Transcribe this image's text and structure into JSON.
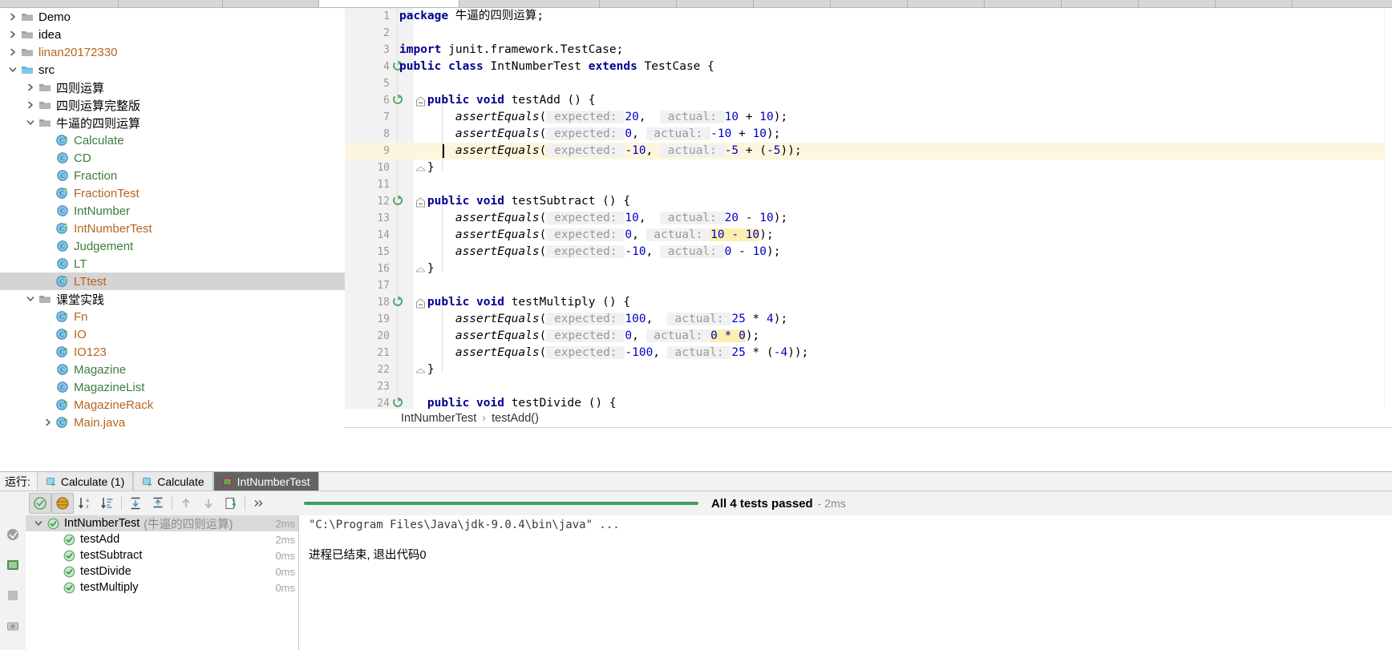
{
  "window": {
    "editor_tabs_cut_off": true
  },
  "project_tree": {
    "items": [
      {
        "label": "Demo",
        "indent": 1,
        "arrow": "collapsed",
        "icon": "folder-icon",
        "color": "black",
        "selected": false
      },
      {
        "label": "idea",
        "indent": 1,
        "arrow": "collapsed",
        "icon": "folder-icon",
        "color": "black",
        "selected": false
      },
      {
        "label": "linan20172330",
        "indent": 1,
        "arrow": "collapsed",
        "icon": "folder-icon",
        "color": "orange",
        "selected": false
      },
      {
        "label": "src",
        "indent": 1,
        "arrow": "expanded",
        "icon": "source-folder-icon",
        "color": "black",
        "selected": false
      },
      {
        "label": "四则运算",
        "indent": 2,
        "arrow": "collapsed",
        "icon": "package-icon",
        "color": "black",
        "selected": false
      },
      {
        "label": "四则运算完整版",
        "indent": 2,
        "arrow": "collapsed",
        "icon": "package-icon",
        "color": "black",
        "selected": false
      },
      {
        "label": "牛逼的四则运算",
        "indent": 2,
        "arrow": "expanded",
        "icon": "package-icon",
        "color": "black",
        "selected": false
      },
      {
        "label": "Calculate",
        "indent": 3,
        "arrow": "none",
        "icon": "java-class-run-icon",
        "color": "green",
        "selected": false
      },
      {
        "label": "CD",
        "indent": 3,
        "arrow": "none",
        "icon": "java-class-icon",
        "color": "green",
        "selected": false
      },
      {
        "label": "Fraction",
        "indent": 3,
        "arrow": "none",
        "icon": "java-class-icon",
        "color": "green",
        "selected": false
      },
      {
        "label": "FractionTest",
        "indent": 3,
        "arrow": "none",
        "icon": "java-test-class-icon",
        "color": "orange",
        "selected": false
      },
      {
        "label": "IntNumber",
        "indent": 3,
        "arrow": "none",
        "icon": "java-class-icon",
        "color": "green",
        "selected": false
      },
      {
        "label": "IntNumberTest",
        "indent": 3,
        "arrow": "none",
        "icon": "java-test-class-icon",
        "color": "orange",
        "selected": false
      },
      {
        "label": "Judgement",
        "indent": 3,
        "arrow": "none",
        "icon": "java-class-icon",
        "color": "green",
        "selected": false
      },
      {
        "label": "LT",
        "indent": 3,
        "arrow": "none",
        "icon": "java-class-icon",
        "color": "green",
        "selected": false
      },
      {
        "label": "LTtest",
        "indent": 3,
        "arrow": "none",
        "icon": "java-test-class-icon",
        "color": "orange",
        "selected": true
      },
      {
        "label": "课堂实践",
        "indent": 2,
        "arrow": "expanded",
        "icon": "package-icon",
        "color": "black",
        "selected": false
      },
      {
        "label": "Fn",
        "indent": 3,
        "arrow": "none",
        "icon": "java-class-run-icon",
        "color": "orange",
        "selected": false
      },
      {
        "label": "IO",
        "indent": 3,
        "arrow": "none",
        "icon": "java-class-run-icon",
        "color": "orange",
        "selected": false
      },
      {
        "label": "IO123",
        "indent": 3,
        "arrow": "none",
        "icon": "java-class-run-icon",
        "color": "orange",
        "selected": false
      },
      {
        "label": "Magazine",
        "indent": 3,
        "arrow": "none",
        "icon": "java-class-icon",
        "color": "green",
        "selected": false
      },
      {
        "label": "MagazineList",
        "indent": 3,
        "arrow": "none",
        "icon": "java-class-icon",
        "color": "green",
        "selected": false
      },
      {
        "label": "MagazineRack",
        "indent": 3,
        "arrow": "none",
        "icon": "java-class-run-icon",
        "color": "orange",
        "selected": false
      },
      {
        "label": "Main.java",
        "indent": 3,
        "arrow": "collapsed",
        "icon": "java-class-run-icon",
        "color": "orange",
        "selected": false
      }
    ]
  },
  "editor": {
    "breadcrumb": {
      "class": "IntNumberTest",
      "separator": "›",
      "member": "testAdd()"
    },
    "current_line": 9,
    "lines": [
      {
        "n": 1,
        "runmark": false,
        "fold": "none",
        "tokens": [
          {
            "t": "package ",
            "c": "kw"
          },
          {
            "t": "牛逼的四则运算",
            "c": "plain"
          },
          {
            "t": ";",
            "c": "plain"
          }
        ]
      },
      {
        "n": 2,
        "runmark": false,
        "fold": "none",
        "tokens": []
      },
      {
        "n": 3,
        "runmark": false,
        "fold": "none",
        "tokens": [
          {
            "t": "import ",
            "c": "kw"
          },
          {
            "t": "junit.framework.TestCase;",
            "c": "plain"
          }
        ]
      },
      {
        "n": 4,
        "runmark": true,
        "fold": "none",
        "tokens": [
          {
            "t": "public class ",
            "c": "kw"
          },
          {
            "t": "IntNumberTest ",
            "c": "plain"
          },
          {
            "t": "extends ",
            "c": "kw"
          },
          {
            "t": "TestCase {",
            "c": "plain"
          }
        ]
      },
      {
        "n": 5,
        "runmark": false,
        "fold": "none",
        "tokens": []
      },
      {
        "n": 6,
        "runmark": true,
        "fold": "start",
        "indent": 1,
        "tokens": [
          {
            "t": "    ",
            "c": "plain"
          },
          {
            "t": "public void ",
            "c": "kw"
          },
          {
            "t": "testAdd () {",
            "c": "plain"
          }
        ]
      },
      {
        "n": 7,
        "runmark": false,
        "fold": "none",
        "indent": 1,
        "tokens": [
          {
            "t": "        ",
            "c": "plain"
          },
          {
            "t": "assertEquals",
            "c": "mth"
          },
          {
            "t": "(",
            "c": "plain"
          },
          {
            "t": " expected: ",
            "c": "hint"
          },
          {
            "t": "20",
            "c": "num"
          },
          {
            "t": ",  ",
            "c": "plain"
          },
          {
            "t": " actual: ",
            "c": "hint"
          },
          {
            "t": "10",
            "c": "num"
          },
          {
            "t": " + ",
            "c": "plain"
          },
          {
            "t": "10",
            "c": "num"
          },
          {
            "t": ");",
            "c": "plain"
          }
        ]
      },
      {
        "n": 8,
        "runmark": false,
        "fold": "none",
        "indent": 1,
        "tokens": [
          {
            "t": "        ",
            "c": "plain"
          },
          {
            "t": "assertEquals",
            "c": "mth"
          },
          {
            "t": "(",
            "c": "plain"
          },
          {
            "t": " expected: ",
            "c": "hint"
          },
          {
            "t": "0",
            "c": "num"
          },
          {
            "t": ", ",
            "c": "plain"
          },
          {
            "t": " actual: ",
            "c": "hint"
          },
          {
            "t": "-10",
            "c": "num"
          },
          {
            "t": " + ",
            "c": "plain"
          },
          {
            "t": "10",
            "c": "num"
          },
          {
            "t": ");",
            "c": "plain"
          }
        ]
      },
      {
        "n": 9,
        "runmark": false,
        "fold": "none",
        "indent": 1,
        "caret": true,
        "tokens": [
          {
            "t": "        ",
            "c": "plain"
          },
          {
            "t": "assertEquals",
            "c": "mth"
          },
          {
            "t": "(",
            "c": "plain"
          },
          {
            "t": " expected: ",
            "c": "hint"
          },
          {
            "t": "-10",
            "c": "num"
          },
          {
            "t": ", ",
            "c": "plain"
          },
          {
            "t": " actual: ",
            "c": "hint"
          },
          {
            "t": "-5",
            "c": "num"
          },
          {
            "t": " + (",
            "c": "plain"
          },
          {
            "t": "-5",
            "c": "num"
          },
          {
            "t": "));",
            "c": "plain"
          }
        ]
      },
      {
        "n": 10,
        "runmark": false,
        "fold": "end",
        "tokens": [
          {
            "t": "    }",
            "c": "plain"
          }
        ]
      },
      {
        "n": 11,
        "runmark": false,
        "fold": "none",
        "tokens": []
      },
      {
        "n": 12,
        "runmark": true,
        "fold": "start",
        "indent": 1,
        "tokens": [
          {
            "t": "    ",
            "c": "plain"
          },
          {
            "t": "public void ",
            "c": "kw"
          },
          {
            "t": "testSubtract () {",
            "c": "plain"
          }
        ]
      },
      {
        "n": 13,
        "runmark": false,
        "fold": "none",
        "indent": 1,
        "tokens": [
          {
            "t": "        ",
            "c": "plain"
          },
          {
            "t": "assertEquals",
            "c": "mth"
          },
          {
            "t": "(",
            "c": "plain"
          },
          {
            "t": " expected: ",
            "c": "hint"
          },
          {
            "t": "10",
            "c": "num"
          },
          {
            "t": ",  ",
            "c": "plain"
          },
          {
            "t": " actual: ",
            "c": "hint"
          },
          {
            "t": "20",
            "c": "num"
          },
          {
            "t": " - ",
            "c": "plain"
          },
          {
            "t": "10",
            "c": "num"
          },
          {
            "t": ");",
            "c": "plain"
          }
        ]
      },
      {
        "n": 14,
        "runmark": false,
        "fold": "none",
        "indent": 1,
        "tokens": [
          {
            "t": "        ",
            "c": "plain"
          },
          {
            "t": "assertEquals",
            "c": "mth"
          },
          {
            "t": "(",
            "c": "plain"
          },
          {
            "t": " expected: ",
            "c": "hint"
          },
          {
            "t": "0",
            "c": "num"
          },
          {
            "t": ", ",
            "c": "plain"
          },
          {
            "t": " actual: ",
            "c": "hint"
          },
          {
            "t": "10 - 10",
            "c": "num hl-yellow"
          },
          {
            "t": ");",
            "c": "plain"
          }
        ]
      },
      {
        "n": 15,
        "runmark": false,
        "fold": "none",
        "indent": 1,
        "tokens": [
          {
            "t": "        ",
            "c": "plain"
          },
          {
            "t": "assertEquals",
            "c": "mth"
          },
          {
            "t": "(",
            "c": "plain"
          },
          {
            "t": " expected: ",
            "c": "hint"
          },
          {
            "t": "-10",
            "c": "num"
          },
          {
            "t": ", ",
            "c": "plain"
          },
          {
            "t": " actual: ",
            "c": "hint"
          },
          {
            "t": "0",
            "c": "num"
          },
          {
            "t": " - ",
            "c": "plain"
          },
          {
            "t": "10",
            "c": "num"
          },
          {
            "t": ");",
            "c": "plain"
          }
        ]
      },
      {
        "n": 16,
        "runmark": false,
        "fold": "end",
        "tokens": [
          {
            "t": "    }",
            "c": "plain"
          }
        ]
      },
      {
        "n": 17,
        "runmark": false,
        "fold": "none",
        "tokens": []
      },
      {
        "n": 18,
        "runmark": true,
        "fold": "start",
        "indent": 1,
        "tokens": [
          {
            "t": "    ",
            "c": "plain"
          },
          {
            "t": "public void ",
            "c": "kw"
          },
          {
            "t": "testMultiply () {",
            "c": "plain"
          }
        ]
      },
      {
        "n": 19,
        "runmark": false,
        "fold": "none",
        "indent": 1,
        "tokens": [
          {
            "t": "        ",
            "c": "plain"
          },
          {
            "t": "assertEquals",
            "c": "mth"
          },
          {
            "t": "(",
            "c": "plain"
          },
          {
            "t": " expected: ",
            "c": "hint"
          },
          {
            "t": "100",
            "c": "num"
          },
          {
            "t": ",  ",
            "c": "plain"
          },
          {
            "t": " actual: ",
            "c": "hint"
          },
          {
            "t": "25",
            "c": "num"
          },
          {
            "t": " * ",
            "c": "plain"
          },
          {
            "t": "4",
            "c": "num"
          },
          {
            "t": ");",
            "c": "plain"
          }
        ]
      },
      {
        "n": 20,
        "runmark": false,
        "fold": "none",
        "indent": 1,
        "tokens": [
          {
            "t": "        ",
            "c": "plain"
          },
          {
            "t": "assertEquals",
            "c": "mth"
          },
          {
            "t": "(",
            "c": "plain"
          },
          {
            "t": " expected: ",
            "c": "hint"
          },
          {
            "t": "0",
            "c": "num"
          },
          {
            "t": ", ",
            "c": "plain"
          },
          {
            "t": " actual: ",
            "c": "hint"
          },
          {
            "t": "0 * 0",
            "c": "num hl-yellow"
          },
          {
            "t": ");",
            "c": "plain"
          }
        ]
      },
      {
        "n": 21,
        "runmark": false,
        "fold": "none",
        "indent": 1,
        "tokens": [
          {
            "t": "        ",
            "c": "plain"
          },
          {
            "t": "assertEquals",
            "c": "mth"
          },
          {
            "t": "(",
            "c": "plain"
          },
          {
            "t": " expected: ",
            "c": "hint"
          },
          {
            "t": "-100",
            "c": "num"
          },
          {
            "t": ", ",
            "c": "plain"
          },
          {
            "t": " actual: ",
            "c": "hint"
          },
          {
            "t": "25",
            "c": "num"
          },
          {
            "t": " * (",
            "c": "plain"
          },
          {
            "t": "-4",
            "c": "num"
          },
          {
            "t": "));",
            "c": "plain"
          }
        ]
      },
      {
        "n": 22,
        "runmark": false,
        "fold": "end",
        "tokens": [
          {
            "t": "    }",
            "c": "plain"
          }
        ]
      },
      {
        "n": 23,
        "runmark": false,
        "fold": "none",
        "tokens": []
      },
      {
        "n": 24,
        "runmark": true,
        "fold": "none",
        "indent": 1,
        "tokens": [
          {
            "t": "    ",
            "c": "plain"
          },
          {
            "t": "public void ",
            "c": "kw"
          },
          {
            "t": "testDivide () {",
            "c": "plain"
          }
        ]
      }
    ]
  },
  "run_window": {
    "label": "运行:",
    "tabs": [
      {
        "label": "Calculate (1)",
        "icon": "run-config-icon",
        "active": false
      },
      {
        "label": "Calculate",
        "icon": "run-config-icon",
        "active": false
      },
      {
        "label": "IntNumberTest",
        "icon": "test-config-icon",
        "active": true
      }
    ],
    "left_buttons": [
      {
        "name": "rerun-button",
        "icon": "play-icon"
      },
      {
        "name": "rerun-failed-button",
        "icon": "rerun-failed-icon"
      },
      {
        "name": "toggle-auto-test-button",
        "icon": "auto-test-icon"
      },
      {
        "name": "stop-button",
        "icon": "stop-icon"
      },
      {
        "name": "dump-threads-button",
        "icon": "camera-icon"
      }
    ],
    "toolbar_buttons": [
      {
        "name": "show-passed-button",
        "icon": "passed-check-icon",
        "pressed": true
      },
      {
        "name": "show-ignored-button",
        "icon": "ignored-icon",
        "pressed": true
      },
      {
        "name": "sort-alphabetically-button",
        "icon": "sort-az-icon",
        "pressed": false
      },
      {
        "name": "sort-by-duration-button",
        "icon": "sort-duration-icon",
        "pressed": false
      },
      {
        "name": "expand-all-button",
        "icon": "expand-all-icon",
        "pressed": false
      },
      {
        "name": "collapse-all-button",
        "icon": "collapse-all-icon",
        "pressed": false
      },
      {
        "name": "prev-failed-button",
        "icon": "arrow-up-icon",
        "pressed": false
      },
      {
        "name": "next-failed-button",
        "icon": "arrow-down-icon",
        "pressed": false
      },
      {
        "name": "export-button",
        "icon": "export-icon",
        "pressed": false
      },
      {
        "name": "more-options-button",
        "icon": "chevron-double-right-icon",
        "pressed": false
      }
    ],
    "progress": {
      "status": "All 4 tests passed",
      "duration": "- 2ms",
      "bar_color": "#3c9f5e"
    },
    "test_tree": {
      "root": {
        "label": "IntNumberTest",
        "subtitle": "(牛逼的四则运算)",
        "duration": "2ms",
        "status": "passed",
        "expanded": true
      },
      "tests": [
        {
          "label": "testAdd",
          "duration": "2ms",
          "status": "passed"
        },
        {
          "label": "testSubtract",
          "duration": "0ms",
          "status": "passed"
        },
        {
          "label": "testDivide",
          "duration": "0ms",
          "status": "passed"
        },
        {
          "label": "testMultiply",
          "duration": "0ms",
          "status": "passed"
        }
      ]
    },
    "console": {
      "command_line": "\"C:\\Program Files\\Java\\jdk-9.0.4\\bin\\java\" ...",
      "exit_line": "进程已结束, 退出代码0"
    }
  },
  "colors": {
    "accent_green": "#3c9f5e",
    "selection_gray": "#d4d4d4",
    "active_tab_dark": "#636363",
    "keyword_blue": "#00008f",
    "number_blue": "#0000c0",
    "hint_gray": "#9a9a9a",
    "highlight_yellow": "#fcf0b0",
    "current_line_yellow": "#fdf6dd",
    "class_green": "#3c7d3c",
    "class_orange": "#b5651d"
  }
}
